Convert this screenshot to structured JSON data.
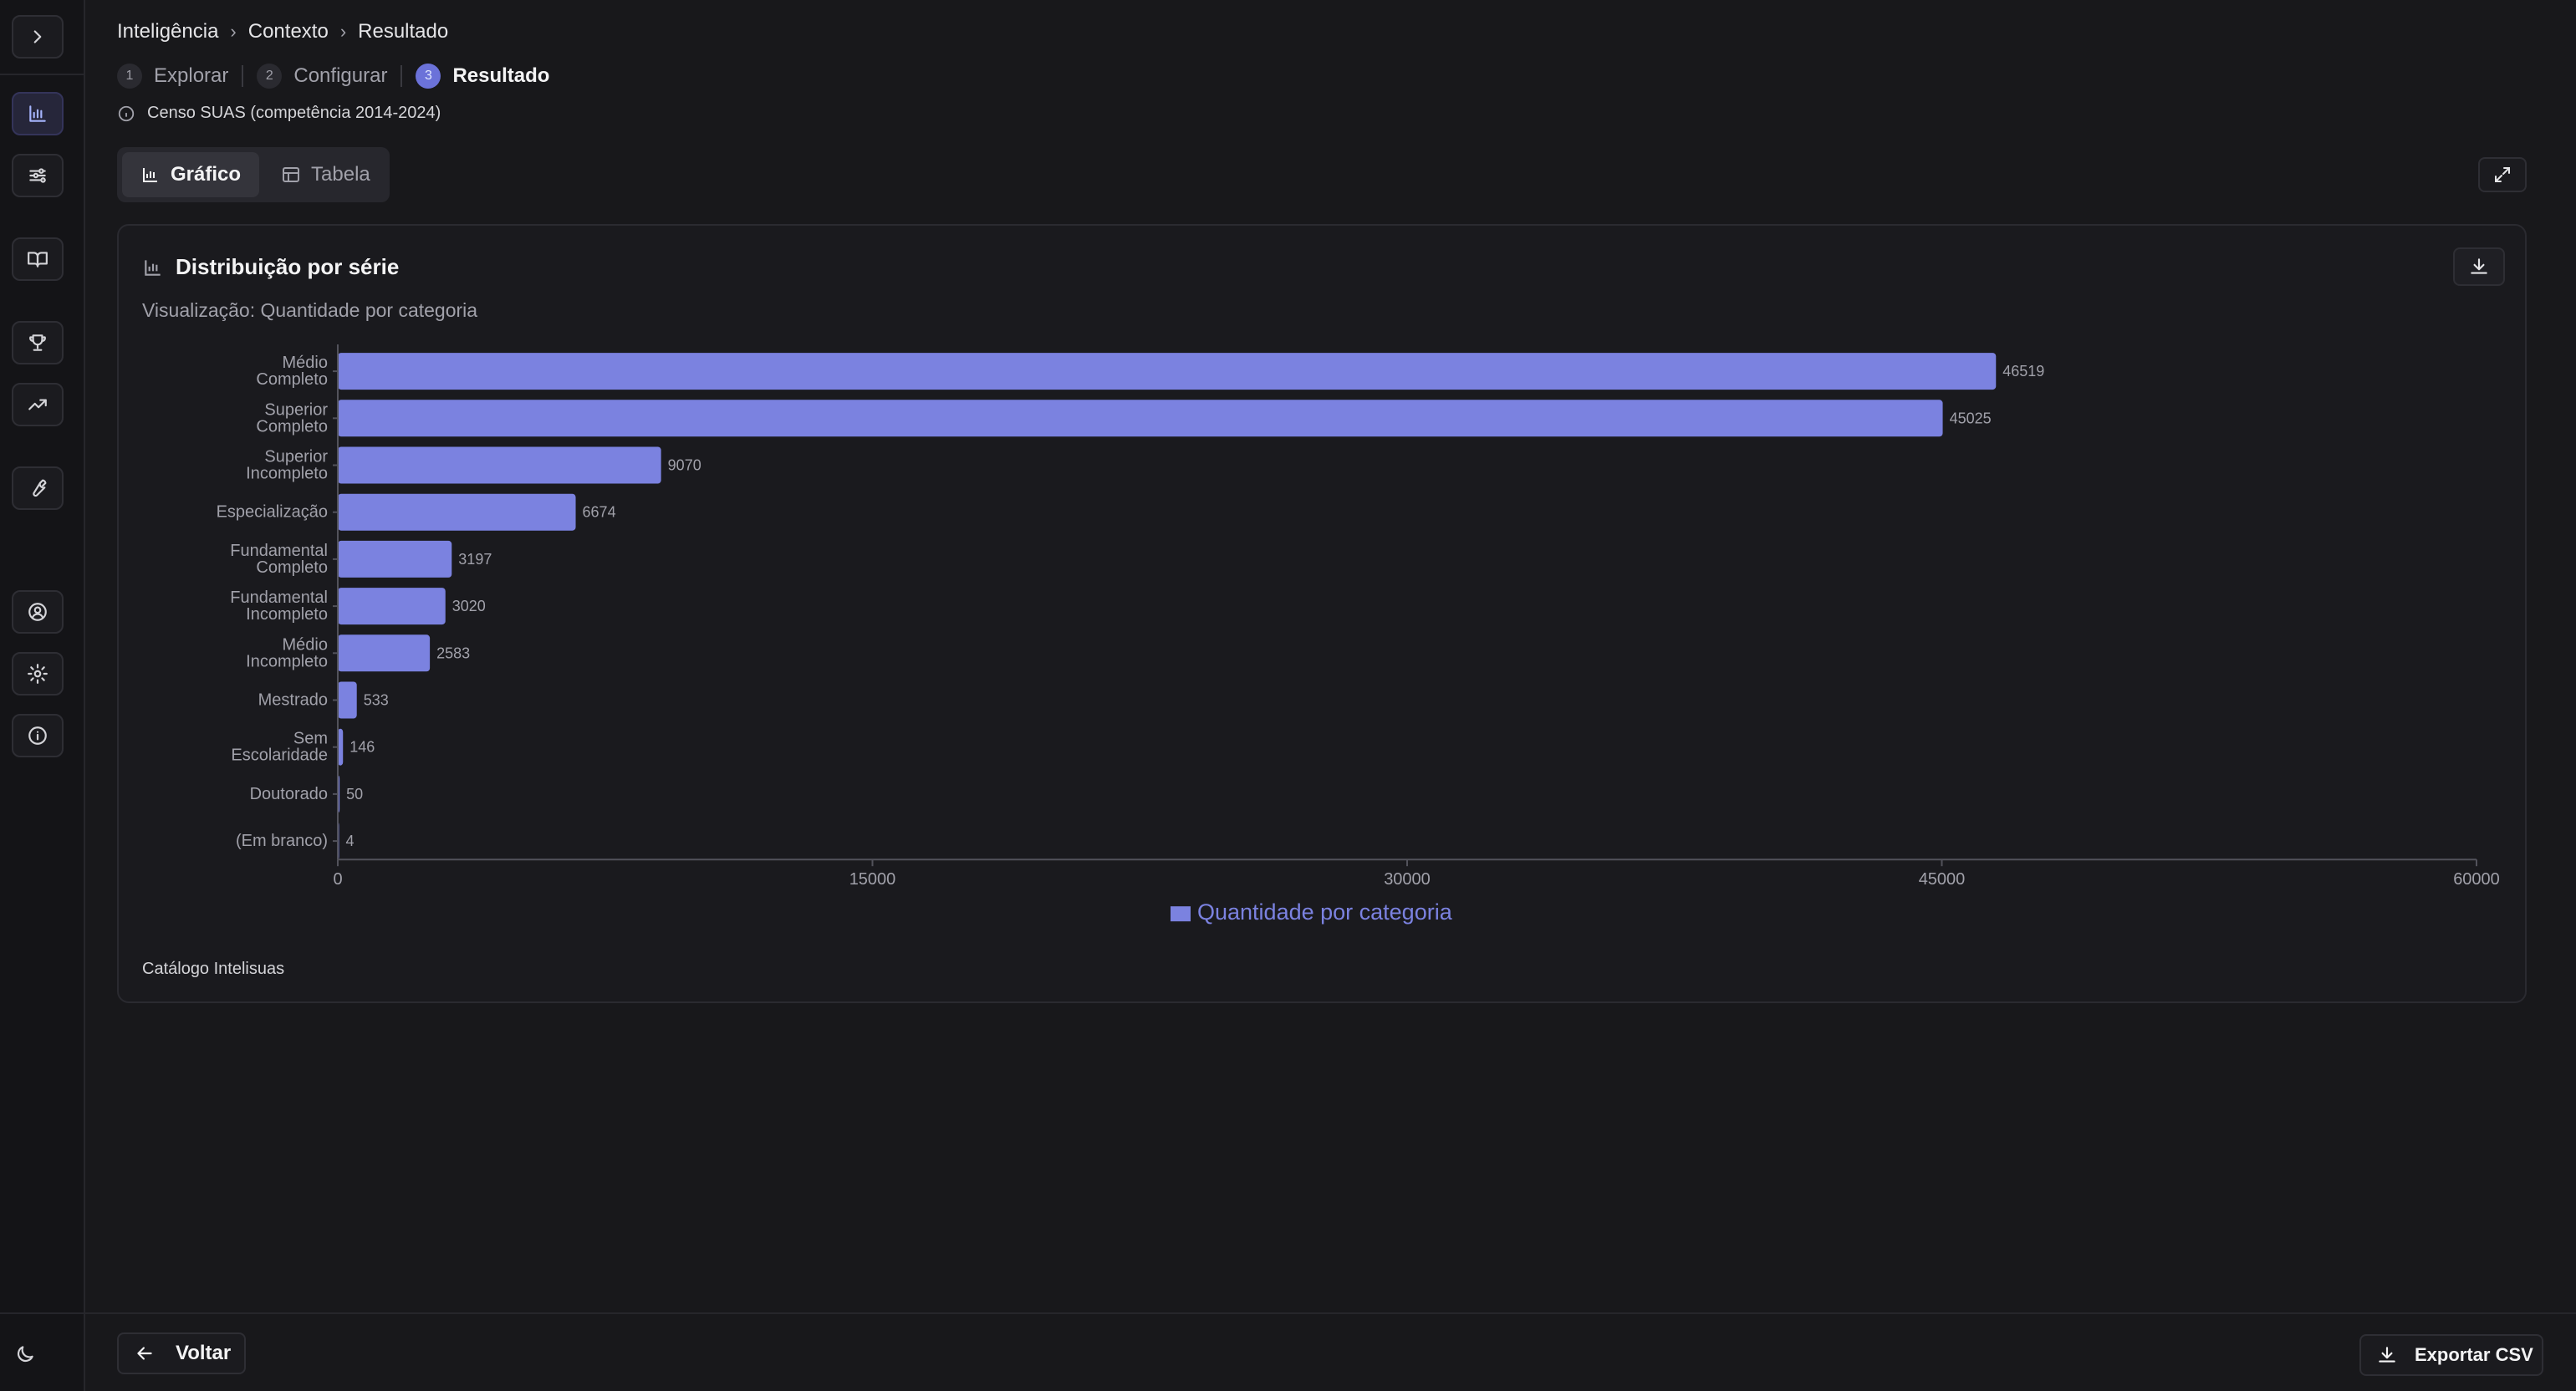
{
  "breadcrumb": [
    "Inteligência",
    "Contexto",
    "Resultado"
  ],
  "steps": [
    {
      "num": "1",
      "label": "Explorar"
    },
    {
      "num": "2",
      "label": "Configurar"
    },
    {
      "num": "3",
      "label": "Resultado"
    }
  ],
  "source": "Censo SUAS (competência 2014-2024)",
  "view_toggle": {
    "chart": "Gráfico",
    "table": "Tabela"
  },
  "card": {
    "title": "Distribuição por série",
    "subtitle": "Visualização: Quantidade por categoria",
    "footer": "Catálogo Intelisuas"
  },
  "chart_data": {
    "type": "bar",
    "orientation": "horizontal",
    "categories": [
      "Médio Completo",
      "Superior Completo",
      "Superior Incompleto",
      "Especialização",
      "Fundamental Completo",
      "Fundamental Incompleto",
      "Médio Incompleto",
      "Mestrado",
      "Sem Escolaridade",
      "Doutorado",
      "(Em branco)"
    ],
    "series": [
      {
        "name": "Quantidade por categoria",
        "values": [
          46519,
          45025,
          9070,
          6674,
          3197,
          3020,
          2583,
          533,
          146,
          50,
          4
        ]
      }
    ],
    "xlim": [
      0,
      60000
    ],
    "xticks": [
      "0",
      "15000",
      "30000",
      "45000",
      "60000"
    ],
    "grid": false,
    "legend": "bottom",
    "color": "#7b82e0"
  },
  "footer_actions": {
    "back": "Voltar",
    "export": "Exportar CSV"
  },
  "colors": {
    "background": "#18181b",
    "accent": "#7b82e0"
  }
}
